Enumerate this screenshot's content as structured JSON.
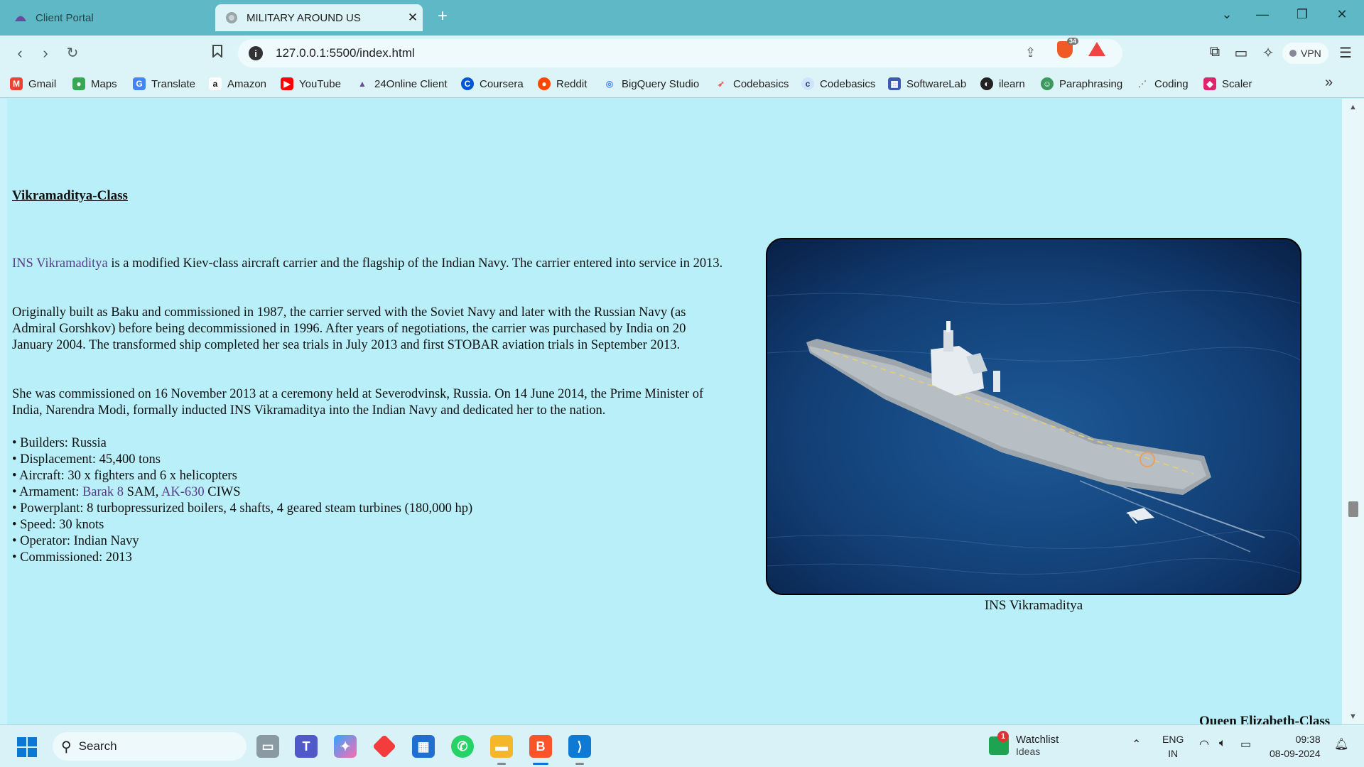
{
  "browser": {
    "tabs": [
      {
        "title": "Client Portal",
        "active": false
      },
      {
        "title": "MILITARY AROUND US",
        "active": true
      }
    ],
    "url": "127.0.0.1:5500/index.html",
    "shield_count": "34",
    "vpn_label": "VPN",
    "bookmarks": [
      "Gmail",
      "Maps",
      "Translate",
      "Amazon",
      "YouTube",
      "24Online Client",
      "Coursera",
      "Reddit",
      "BigQuery Studio",
      "Codebasics",
      "Codebasics",
      "SoftwareLab",
      "ilearn",
      "Paraphrasing",
      "Coding",
      "Scaler"
    ]
  },
  "page": {
    "section_title": "Vikramaditya-Class",
    "para1": {
      "link": "INS Vikramaditya",
      "text": " is a modified Kiev-class aircraft carrier and the flagship of the Indian Navy. The carrier entered into service in 2013."
    },
    "para2": "Originally built as Baku and commissioned in 1987, the carrier served with the Soviet Navy and later with the Russian Navy (as Admiral Gorshkov) before being decommissioned in 1996. After years of negotiations, the carrier was purchased by India on 20 January 2004. The transformed ship completed her sea trials in July 2013 and first STOBAR aviation trials in September 2013.",
    "para3": "She was commissioned on 16 November 2013 at a ceremony held at Severodvinsk, Russia. On 14 June 2014, the Prime Minister of India, Narendra Modi, formally inducted INS Vikramaditya into the Indian Navy and dedicated her to the nation.",
    "specs": {
      "builders": "• Builders: Russia",
      "displacement": "• Displacement: 45,400 tons",
      "aircraft": "• Aircraft: 30 x fighters and 6 x helicopters",
      "armament_prefix": "• Armament: ",
      "armament_link1": "Barak 8",
      "armament_mid": " SAM, ",
      "armament_link2": "AK-630",
      "armament_suffix": " CIWS",
      "powerplant": "• Powerplant: 8 turbopressurized boilers, 4 shafts, 4 geared steam turbines (180,000 hp)",
      "speed": "• Speed: 30 knots",
      "operator": "• Operator: Indian Navy",
      "commissioned": "• Commissioned: 2013"
    },
    "image_caption": "INS Vikramaditya",
    "next_section_title": "Queen Elizabeth-Class"
  },
  "taskbar": {
    "search_label": "Search",
    "watchlist_title": "Watchlist",
    "watchlist_sub": "Ideas",
    "watchlist_badge": "1",
    "lang_top": "ENG",
    "lang_bottom": "IN",
    "time": "09:38",
    "date": "08-09-2024"
  },
  "colors": {
    "page_background": "#b8eff9",
    "link": "#5a3d8a",
    "tabstrip": "#5eb8c5"
  }
}
